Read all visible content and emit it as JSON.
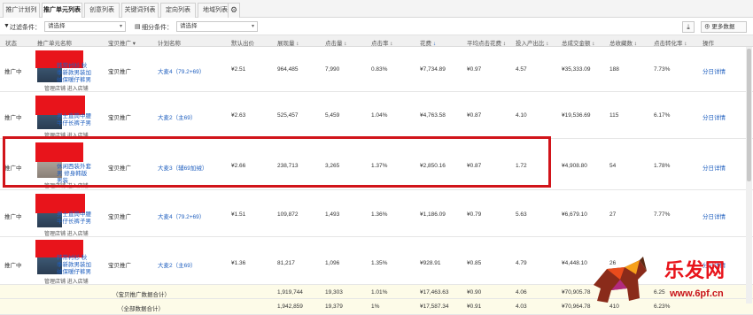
{
  "tabs": [
    "推广计划列表",
    "推广单元列表",
    "创意列表",
    "关键词列表",
    "定向列表",
    "地域列表"
  ],
  "settings_icon": "gear-icon",
  "filters": {
    "filter1_label": "过滤条件：",
    "filter1_value": "请选择",
    "filter2_label": "细分条件：",
    "filter2_value": "请选择",
    "download_icon": "download-icon",
    "more_data": "更多数据"
  },
  "columns": [
    "状态",
    "推广单元名称",
    "宝贝推广",
    "计划名称",
    "默认出价",
    "展现量",
    "点击量",
    "点击率",
    "花费",
    "平均点击花费",
    "投入产出比",
    "总成交金额",
    "总收藏数",
    "点击转化率",
    "操作"
  ],
  "rows": [
    {
      "status": "推广中",
      "title": "韩常衬衫 秋季新款男装加绒保暖仔裤男",
      "links": "管理店铺  进入店铺",
      "type": "宝贝推广",
      "plan": "大麦4（79.2+69）",
      "bid": "¥2.51",
      "impressions": "964,485",
      "clicks": "7,990",
      "ctr": "0.83%",
      "cost": "¥7,734.89",
      "cpc": "¥0.97",
      "roi": "4.57",
      "gmv": "¥35,333.09",
      "favs": "188",
      "cvr": "7.73%",
      "action": "分日详情"
    },
    {
      "status": "推广中",
      "title": "男士直筒中腰 牛仔长裤子男",
      "links": "管理店铺  进入店铺",
      "type": "宝贝推广",
      "plan": "大麦2（主69）",
      "bid": "¥2.63",
      "impressions": "525,457",
      "clicks": "5,459",
      "ctr": "1.04%",
      "cost": "¥4,763.58",
      "cpc": "¥0.87",
      "roi": "4.10",
      "gmv": "¥19,536.69",
      "favs": "115",
      "cvr": "6.17%",
      "action": "分日详情"
    },
    {
      "status": "推广中",
      "title": "休闲西装外套男 修身韩版男装",
      "links": "管理店铺  进入店铺",
      "type": "宝贝推广",
      "plan": "大麦3（辅69加绒）",
      "bid": "¥2.66",
      "impressions": "238,713",
      "clicks": "3,265",
      "ctr": "1.37%",
      "cost": "¥2,850.16",
      "cpc": "¥0.87",
      "roi": "1.72",
      "gmv": "¥4,908.80",
      "favs": "54",
      "cvr": "1.78%",
      "action": "分日详情"
    },
    {
      "status": "推广中",
      "title": "男士直筒中腰 牛仔长裤子男",
      "links": "管理店铺  进入店铺",
      "type": "宝贝推广",
      "plan": "大麦4（79.2+69）",
      "bid": "¥1.51",
      "impressions": "109,872",
      "clicks": "1,493",
      "ctr": "1.36%",
      "cost": "¥1,186.09",
      "cpc": "¥0.79",
      "roi": "5.63",
      "gmv": "¥6,679.10",
      "favs": "27",
      "cvr": "7.77%",
      "action": "分日详情"
    },
    {
      "status": "推广中",
      "title": "韩常衬衫 秋季新款男装加绒保暖仔裤男",
      "links": "管理店铺  进入店铺",
      "type": "宝贝推广",
      "plan": "大麦2（主69）",
      "bid": "¥1.36",
      "impressions": "81,217",
      "clicks": "1,096",
      "ctr": "1.35%",
      "cost": "¥928.91",
      "cpc": "¥0.85",
      "roi": "4.79",
      "gmv": "¥4,448.10",
      "favs": "26",
      "cvr": "",
      "action": "分日详情"
    }
  ],
  "summary_rows": [
    {
      "label": "（宝贝推广数据合计）",
      "impressions": "1,919,744",
      "clicks": "19,303",
      "ctr": "1.01%",
      "cost": "¥17,463.63",
      "cpc": "¥0.90",
      "roi": "4.06",
      "gmv": "¥70,905.78",
      "favs": "",
      "cvr": "6.25"
    },
    {
      "label": "（全部数据合计）",
      "impressions": "1,942,859",
      "clicks": "19,379",
      "ctr": "1%",
      "cost": "¥17,587.34",
      "cpc": "¥0.91",
      "roi": "4.03",
      "gmv": "¥70,964.78",
      "favs": "410",
      "cvr": "6.23%"
    }
  ],
  "watermark": {
    "text": "乐发网",
    "url": "www.6pf.cn"
  },
  "colors": {
    "highlight": "#d1141a",
    "link": "#1f5fbf",
    "redact": "#e8141b"
  }
}
